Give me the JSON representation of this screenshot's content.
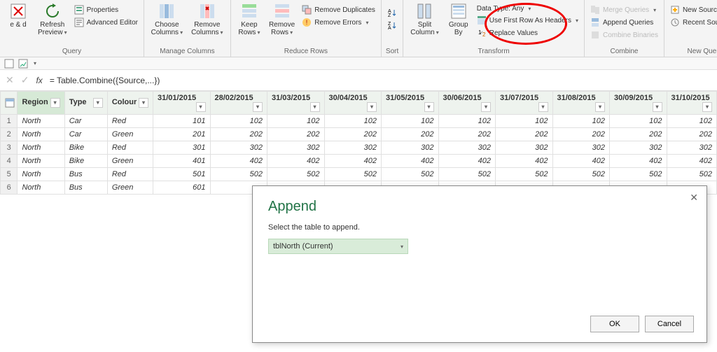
{
  "ribbon": {
    "close_label": "e &\nd",
    "refresh": "Refresh\nPreview",
    "properties": "Properties",
    "adv_editor": "Advanced Editor",
    "choose_cols": "Choose\nColumns",
    "remove_cols": "Remove\nColumns",
    "keep_rows": "Keep\nRows",
    "remove_rows": "Remove\nRows",
    "remove_dup": "Remove Duplicates",
    "remove_err": "Remove Errors",
    "sort_label": "Sort",
    "split_col": "Split\nColumn",
    "group_by": "Group\nBy",
    "data_type": "Data Type: Any",
    "first_row": "Use First Row As Headers",
    "replace_vals": "Replace Values",
    "merge_q": "Merge Queries",
    "append_q": "Append Queries",
    "combine_bin": "Combine Binaries",
    "new_source": "New Source",
    "recent_sources": "Recent Sources",
    "g_query": "Query",
    "g_manage_cols": "Manage Columns",
    "g_reduce_rows": "Reduce Rows",
    "g_sort": "Sort",
    "g_transform": "Transform",
    "g_combine": "Combine",
    "g_new_query": "New Query"
  },
  "formula": "= Table.Combine({Source,...})",
  "table": {
    "headers": [
      "Region",
      "Type",
      "Colour",
      "31/01/2015",
      "28/02/2015",
      "31/03/2015",
      "30/04/2015",
      "31/05/2015",
      "30/06/2015",
      "31/07/2015",
      "31/08/2015",
      "30/09/2015",
      "31/10/2015"
    ],
    "rows": [
      [
        "North",
        "Car",
        "Red",
        "101",
        "102",
        "102",
        "102",
        "102",
        "102",
        "102",
        "102",
        "102",
        "102"
      ],
      [
        "North",
        "Car",
        "Green",
        "201",
        "202",
        "202",
        "202",
        "202",
        "202",
        "202",
        "202",
        "202",
        "202"
      ],
      [
        "North",
        "Bike",
        "Red",
        "301",
        "302",
        "302",
        "302",
        "302",
        "302",
        "302",
        "302",
        "302",
        "302"
      ],
      [
        "North",
        "Bike",
        "Green",
        "401",
        "402",
        "402",
        "402",
        "402",
        "402",
        "402",
        "402",
        "402",
        "402"
      ],
      [
        "North",
        "Bus",
        "Red",
        "501",
        "502",
        "502",
        "502",
        "502",
        "502",
        "502",
        "502",
        "502",
        "502"
      ],
      [
        "North",
        "Bus",
        "Green",
        "601",
        "",
        "",
        "",
        "",
        "",
        "",
        "",
        "",
        ""
      ]
    ]
  },
  "dialog": {
    "title": "Append",
    "prompt": "Select the table to append.",
    "selected": "tblNorth (Current)",
    "ok": "OK",
    "cancel": "Cancel"
  }
}
